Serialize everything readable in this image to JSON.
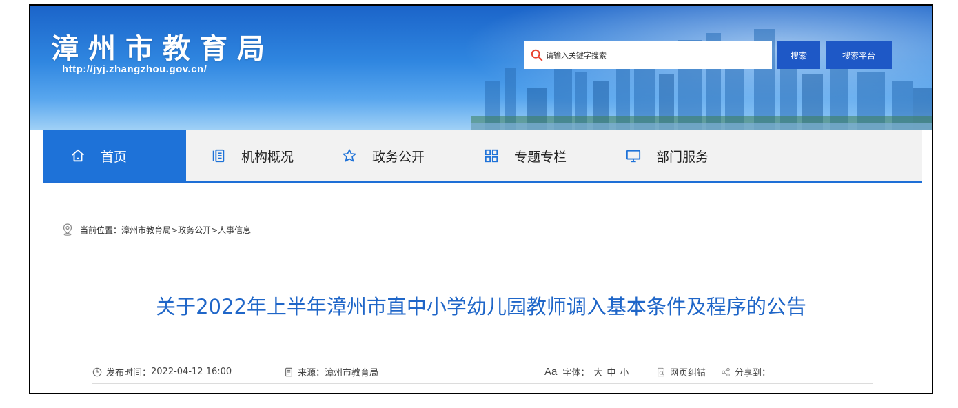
{
  "header": {
    "title": "漳州市教育局",
    "url": "http://jyj.zhangzhou.gov.cn/",
    "search_placeholder": "请输入关键字搜索",
    "search_button": "搜索",
    "platform_button": "搜索平台"
  },
  "nav": {
    "items": [
      {
        "label": "首页",
        "icon": "home-icon",
        "active": true
      },
      {
        "label": "机构概况",
        "icon": "list-icon"
      },
      {
        "label": "政务公开",
        "icon": "star-icon"
      },
      {
        "label": "专题专栏",
        "icon": "grid-icon"
      },
      {
        "label": "部门服务",
        "icon": "monitor-icon"
      }
    ]
  },
  "breadcrumb": {
    "prefix": "当前位置：",
    "path": "漳州市教育局>政务公开>人事信息"
  },
  "article": {
    "title": "关于2022年上半年漳州市直中小学幼儿园教师调入基本条件及程序的公告",
    "publish_label": "发布时间：",
    "publish_time": "2022-04-12 16:00",
    "source_label": "来源：",
    "source": "漳州市教育局",
    "font_icon_text": "Aa",
    "font_label": "字体：",
    "font_sizes": [
      "大",
      "中",
      "小"
    ],
    "correction": "网页纠错",
    "share": "分享到："
  },
  "colors": {
    "accent": "#1e72d8",
    "title_blue": "#1f66c8",
    "search_icon": "#e8432f"
  }
}
